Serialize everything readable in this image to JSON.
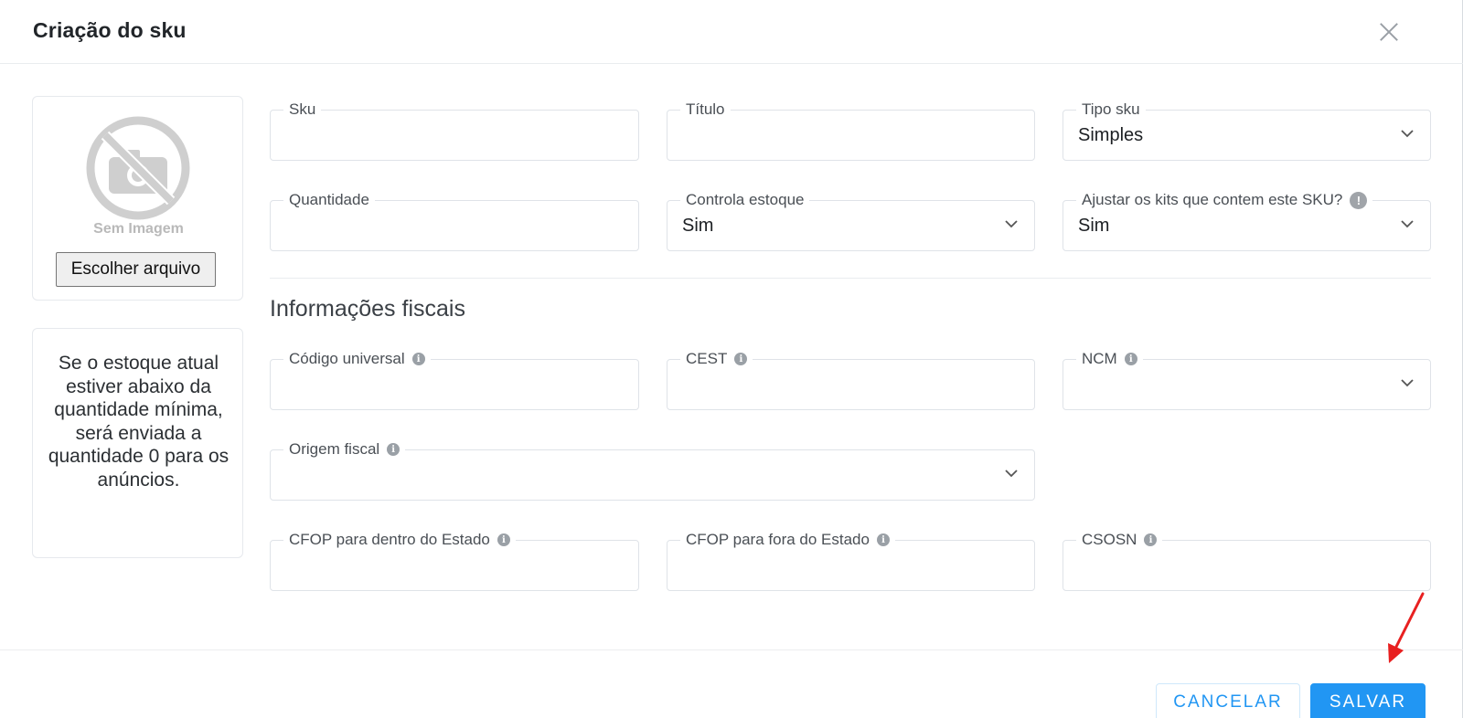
{
  "modal": {
    "title": "Criação do sku"
  },
  "image": {
    "placeholder_label": "Sem Imagem",
    "file_button_label": "Escolher arquivo"
  },
  "info": {
    "text": "Se o estoque atual estiver abaixo da quantidade mínima, será enviada a quantidade 0 para os anúncios."
  },
  "fields": {
    "sku": {
      "label": "Sku",
      "value": ""
    },
    "titulo": {
      "label": "Título",
      "value": ""
    },
    "tipo_sku": {
      "label": "Tipo sku",
      "value": "Simples"
    },
    "quantidade": {
      "label": "Quantidade",
      "value": ""
    },
    "controla_estoque": {
      "label": "Controla estoque",
      "value": "Sim"
    },
    "ajustar_kits": {
      "label": "Ajustar os kits que contem este SKU?",
      "value": "Sim"
    }
  },
  "fiscal": {
    "section_title": "Informações fiscais",
    "codigo_universal": {
      "label": "Código universal",
      "value": ""
    },
    "cest": {
      "label": "CEST",
      "value": ""
    },
    "ncm": {
      "label": "NCM",
      "value": ""
    },
    "origem_fiscal": {
      "label": "Origem fiscal",
      "value": ""
    },
    "cfop_dentro": {
      "label": "CFOP para dentro do Estado",
      "value": ""
    },
    "cfop_fora": {
      "label": "CFOP para fora do Estado",
      "value": ""
    },
    "csosn": {
      "label": "CSOSN",
      "value": ""
    }
  },
  "footer": {
    "cancel_label": "CANCELAR",
    "save_label": "SALVAR"
  },
  "colors": {
    "primary": "#2196f3",
    "annotation_arrow": "#e82020"
  },
  "icons": {
    "close": "close-icon",
    "chevron": "chevron-down-icon",
    "info": "info-icon",
    "help": "help-icon",
    "no_image": "no-camera-icon"
  }
}
